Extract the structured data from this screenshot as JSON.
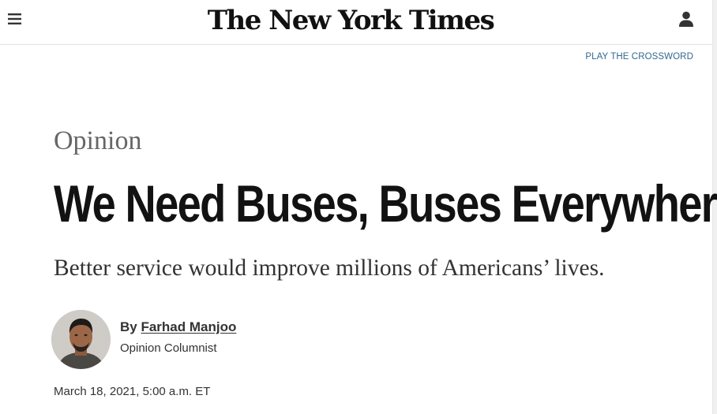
{
  "header": {
    "logo_text": "The New York Times",
    "menu_icon": "hamburger-menu-icon",
    "account_icon": "user-account-icon"
  },
  "crossword_link": "PLAY THE CROSSWORD",
  "article": {
    "section": "Opinion",
    "headline": "We Need Buses, Buses Everywhere",
    "summary": "Better service would improve millions of Americans’ lives.",
    "byline_prefix": "By ",
    "author": "Farhad Manjoo",
    "author_title": "Opinion Columnist",
    "timestamp": "March 18, 2021, 5:00 a.m. ET"
  },
  "colors": {
    "link_blue": "#326891",
    "text_dark": "#121212",
    "section_gray": "#666666"
  }
}
